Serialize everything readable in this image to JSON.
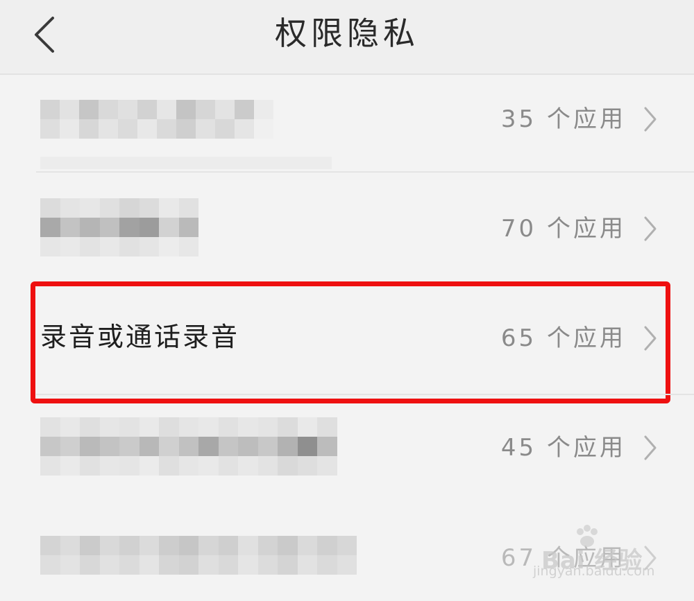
{
  "header": {
    "title": "权限隐私"
  },
  "rows": [
    {
      "label": "",
      "count_text": "35 个应用"
    },
    {
      "label": "",
      "count_text": "70 个应用"
    },
    {
      "label": "录音或通话录音",
      "count_text": "65 个应用"
    },
    {
      "label": "",
      "count_text": "45 个应用"
    },
    {
      "label": "",
      "count_text": "67 个应用"
    }
  ],
  "watermark": {
    "brand": "Bai 经验",
    "url": "jingyan.baidu.com"
  },
  "colors": {
    "highlight_border": "#ee1010",
    "count_text": "#8a8a8a",
    "background": "#f3f3f3"
  }
}
